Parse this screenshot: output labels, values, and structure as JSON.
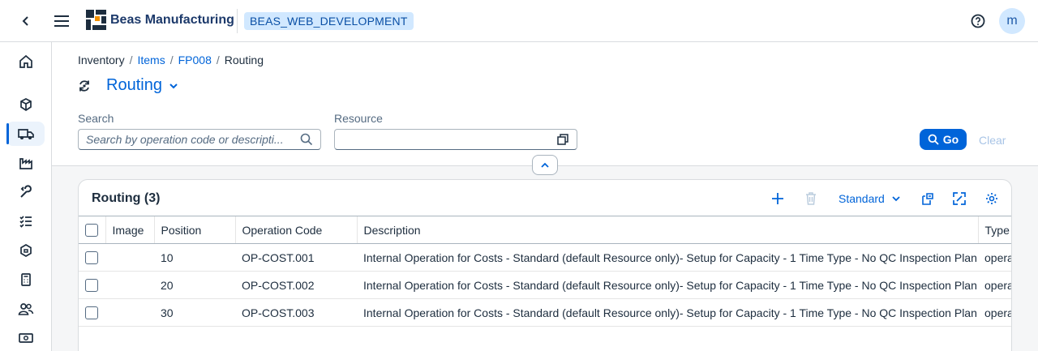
{
  "header": {
    "app_name": "Beas Manufacturing",
    "tenant": "BEAS_WEB_DEVELOPMENT",
    "avatar_initial": "m"
  },
  "sidenav": {
    "items": [
      {
        "icon": "home-icon"
      },
      {
        "icon": "cube-icon"
      },
      {
        "icon": "truck-icon",
        "active": true
      },
      {
        "icon": "factory-icon"
      },
      {
        "icon": "wrench-icon"
      },
      {
        "icon": "checklist-icon"
      },
      {
        "icon": "package-icon"
      },
      {
        "icon": "calculator-icon"
      },
      {
        "icon": "people-icon"
      },
      {
        "icon": "money-icon"
      }
    ]
  },
  "breadcrumb": {
    "items": [
      {
        "label": "Inventory",
        "link": false
      },
      {
        "label": "Items",
        "link": true
      },
      {
        "label": "FP008",
        "link": true
      },
      {
        "label": "Routing",
        "link": false
      }
    ]
  },
  "page": {
    "title": "Routing"
  },
  "filters": {
    "search_label": "Search",
    "search_placeholder": "Search by operation code or descripti...",
    "resource_label": "Resource",
    "resource_value": "",
    "go_label": "Go",
    "clear_label": "Clear"
  },
  "table": {
    "title": "Routing (3)",
    "variant_label": "Standard",
    "columns": [
      "Image",
      "Position",
      "Operation Code",
      "Description",
      "Type"
    ],
    "rows": [
      {
        "image": "",
        "position": "10",
        "operation_code": "OP-COST.001",
        "description": "Internal Operation for Costs - Standard (default Resource only)- Setup for Capacity - 1 Time Type - No QC Inspection Plan",
        "type": "opera"
      },
      {
        "image": "",
        "position": "20",
        "operation_code": "OP-COST.002",
        "description": "Internal Operation for Costs - Standard (default Resource only)- Setup for Capacity - 1 Time Type - No QC Inspection Plan",
        "type": "opera"
      },
      {
        "image": "",
        "position": "30",
        "operation_code": "OP-COST.003",
        "description": "Internal Operation for Costs - Standard (default Resource only)- Setup for Capacity - 1 Time Type - No QC Inspection Plan",
        "type": "opera"
      }
    ]
  },
  "colors": {
    "accent": "#0064d9",
    "tenant_bg": "#d1e8ff",
    "shell_bg": "#ffffff",
    "page_bg": "#f5f6f7"
  }
}
